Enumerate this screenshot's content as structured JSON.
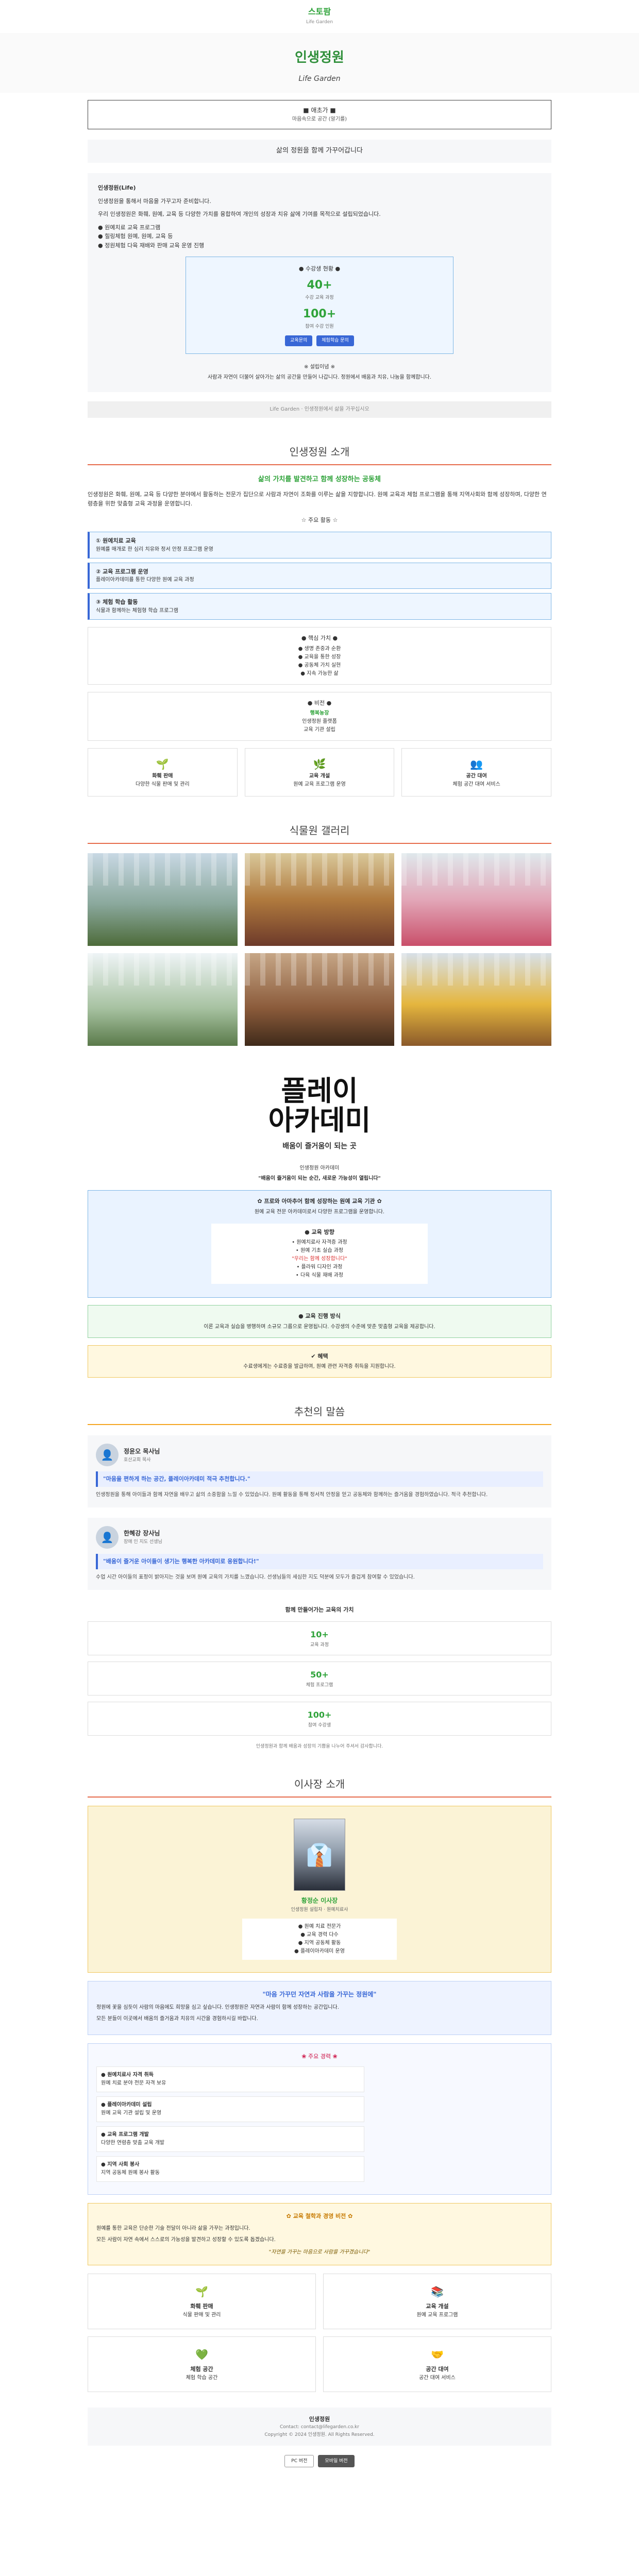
{
  "header": {
    "logo": "스토팜",
    "logo_sub": "Life Garden"
  },
  "hero": {
    "title": "인생정원",
    "subtitle": "Life Garden"
  },
  "notice": {
    "title": "■ 애초가 ■",
    "sub": "마음속으로 공간 (알기를)"
  },
  "intro": {
    "head": "삶의 정원을 함께 가꾸어갑니다",
    "p1_title": "인생정원(Life)",
    "p1": "인생정원을 통해서 마음을 가꾸고자 준비합니다.",
    "p2": "우리 인생정원은 화훼, 원예, 교육 등 다양한 가치를 융합하여 개인의 성장과 치유 삶에 기여를 목적으로 설립되었습니다.",
    "list": [
      "● 원예치료 교육 프로그램",
      "● 힐링체험 원예, 원예, 교육 등",
      "● 정원체험 다육 재배와 판매 교육 운영 진행"
    ],
    "stat": {
      "label": "● 수강생 현황 ●",
      "n1": "40+",
      "c1": "수강 교육 과정",
      "n2": "100+",
      "c2": "참여 수강 인원",
      "btn1": "교육문의",
      "btn2": "체험학습 문의"
    },
    "quote_title": "※ 설립이념 ※",
    "quote": "사람과 자연이 더불어 살아가는 삶의 공간을 만들어 나갑니다. 정원에서 배움과 치유, 나눔을 함께합니다.",
    "footnote": "Life Garden · 인생정원에서 삶을 가꾸십시오"
  },
  "about": {
    "title": "인생정원 소개",
    "head": "삶의 가치를 발견하고 함께 성장하는 공동체",
    "body": "인생정원은 화훼, 원예, 교육 등 다양한 분야에서 활동하는 전문가 집단으로 사람과 자연이 조화를 이루는 삶을 지향합니다. 원예 교육과 체험 프로그램을 통해 지역사회와 함께 성장하며, 다양한 연령층을 위한 맞춤형 교육 과정을 운영합니다.",
    "tag": "☆ 주요 활동 ☆",
    "bars": [
      {
        "t": "① 원예치료 교육",
        "s": "원예를 매개로 한 심리 치유와 정서 안정 프로그램 운영"
      },
      {
        "t": "② 교육 프로그램 운영",
        "s": "플레이아카데미를 통한 다양한 원예 교육 과정"
      },
      {
        "t": "③ 체험 학습 활동",
        "s": "식물과 함께하는 체험형 학습 프로그램"
      }
    ],
    "box1_h": "● 핵심 가치 ●",
    "box1": [
      "● 생명 존중과 순환",
      "● 교육을 통한 성장",
      "● 공동체 가치 실현",
      "● 지속 가능한 삶"
    ],
    "box2_h": "● 비전 ●",
    "box2": [
      "행복농장",
      "인생정원 플랫폼",
      "교육 기관 설립"
    ],
    "cards": [
      {
        "icon": "🌱",
        "t": "화훼 판매",
        "s": "다양한 식물 판매 및 관리"
      },
      {
        "icon": "🌿",
        "t": "교육 개설",
        "s": "원예 교육 프로그램 운영"
      },
      {
        "icon": "👥",
        "t": "공간 대여",
        "s": "체험 공간 대여 서비스"
      }
    ]
  },
  "gallery": {
    "title": "식물원 갤러리"
  },
  "academy": {
    "title_line1": "플레이",
    "title_line2": "아카데미",
    "tagline": "배움이 즐거움이 되는 곳",
    "small_h": "인생정원 아카데미",
    "small": "\"배움이 즐거움이 되는 순간, 새로운 가능성이 열립니다\"",
    "blue_h": "✿ 프로와 아마추어 함께 성장하는 원예 교육 기관 ✿",
    "blue": "원예 교육 전문 아카데미로서 다양한 프로그램을 운영합니다.",
    "inner_h": "● 교육 방향",
    "inner": [
      "• 원예치료사 자격증 과정",
      "• 원예 기초 실습 과정",
      "• 플라워 디자인 과정",
      "• 다육 식물 재배 과정"
    ],
    "inner_red": "\"우리는 함께 성장합니다\"",
    "green_h": "● 교육 진행 방식",
    "green": "이론 교육과 실습을 병행하며 소규모 그룹으로 운영됩니다. 수강생의 수준에 맞춘 맞춤형 교육을 제공합니다.",
    "yellow_h": "✔ 혜택",
    "yellow": "수료생에게는 수료증을 발급하며, 원예 관련 자격증 취득을 지원합니다."
  },
  "reviews": {
    "title": "추천의 말씀",
    "items": [
      {
        "name": "정윤오 목사님",
        "role": "호산교회 목사",
        "quote": "\"마음을 편하게 하는 공간, 플레이아카데미 적극 추천합니다.\"",
        "body": "인생정원을 통해 아이들과 함께 자연을 배우고 삶의 소중함을 느낄 수 있었습니다. 원예 활동을 통해 정서적 안정을 얻고 공동체와 함께하는 즐거움을 경험하였습니다. 적극 추천합니다."
      },
      {
        "name": "한혜강 장사님",
        "role": "장애 인 지도 선생님",
        "quote": "\"배움이 즐거운 아이들이 생기는 행복한 아카데미로 응원합니다!\"",
        "body": "수업 시간 아이들의 표정이 밝아지는 것을 보며 원예 교육의 가치를 느꼈습니다. 선생님들의 세심한 지도 덕분에 모두가 즐겁게 참여할 수 있었습니다."
      }
    ]
  },
  "stats": {
    "title": "함께 만들어가는 교육의 가치",
    "items": [
      {
        "n": "10+",
        "c": "교육 과정"
      },
      {
        "n": "50+",
        "c": "체험 프로그램"
      },
      {
        "n": "100+",
        "c": "참여 수강생"
      }
    ],
    "note": "인생정원과 함께 배움과 성장의 기쁨을 나누어 주셔서 감사합니다."
  },
  "ceo": {
    "title": "이사장 소개",
    "name": "황정순 이사장",
    "role": "인생정원 설립자 · 원예치료사",
    "list": [
      "● 원예 치료 전문가",
      "● 교육 경력 다수",
      "● 지역 공동체 활동",
      "● 플레이아카데미 운영"
    ],
    "msg_h": "\"마음 가꾸던 자연과 사람을 가꾸는 정원에\"",
    "msg": [
      "정원에 꽃을 심듯이 사람의 마음에도 희망을 심고 싶습니다. 인생정원은 자연과 사람이 함께 성장하는 공간입니다.",
      "모든 분들이 이곳에서 배움의 즐거움과 치유의 시간을 경험하시길 바랍니다."
    ],
    "core_h": "❀ 주요 경력 ❀",
    "core": [
      {
        "t": "● 원예치료사 자격 취득",
        "s": "원예 치료 분야 전문 자격 보유"
      },
      {
        "t": "● 플레이아카데미 설립",
        "s": "원예 교육 기관 설립 및 운영"
      },
      {
        "t": "● 교육 프로그램 개발",
        "s": "다양한 연령층 맞춤 교육 개발"
      },
      {
        "t": "● 지역 사회 봉사",
        "s": "지역 공동체 원예 봉사 활동"
      }
    ],
    "phil_h": "✿ 교육 철학과 경영 비전 ✿",
    "phil": [
      "원예를 통한 교육은 단순한 기술 전달이 아니라 삶을 가꾸는 과정입니다.",
      "모든 사람이 자연 속에서 스스로의 가능성을 발견하고 성장할 수 있도록 돕겠습니다."
    ],
    "phil_q": "\"자연을 가꾸는 마음으로 사람을 가꾸겠습니다\""
  },
  "bottom_cards": [
    {
      "icon": "🌱",
      "t": "화훼 판매",
      "s": "식물 판매 및 관리"
    },
    {
      "icon": "📚",
      "t": "교육 개설",
      "s": "원예 교육 프로그램"
    },
    {
      "icon": "💚",
      "t": "체험 공간",
      "s": "체험 학습 공간"
    },
    {
      "icon": "🤝",
      "t": "공간 대여",
      "s": "공간 대여 서비스"
    }
  ],
  "footer": {
    "title": "인생정원",
    "contact": "Contact: contact@lifegarden.co.kr",
    "copy": "Copyright © 2024 인생정원. All Rights Reserved."
  },
  "bottom_btns": [
    "PC 버전",
    "모바일 버전"
  ]
}
